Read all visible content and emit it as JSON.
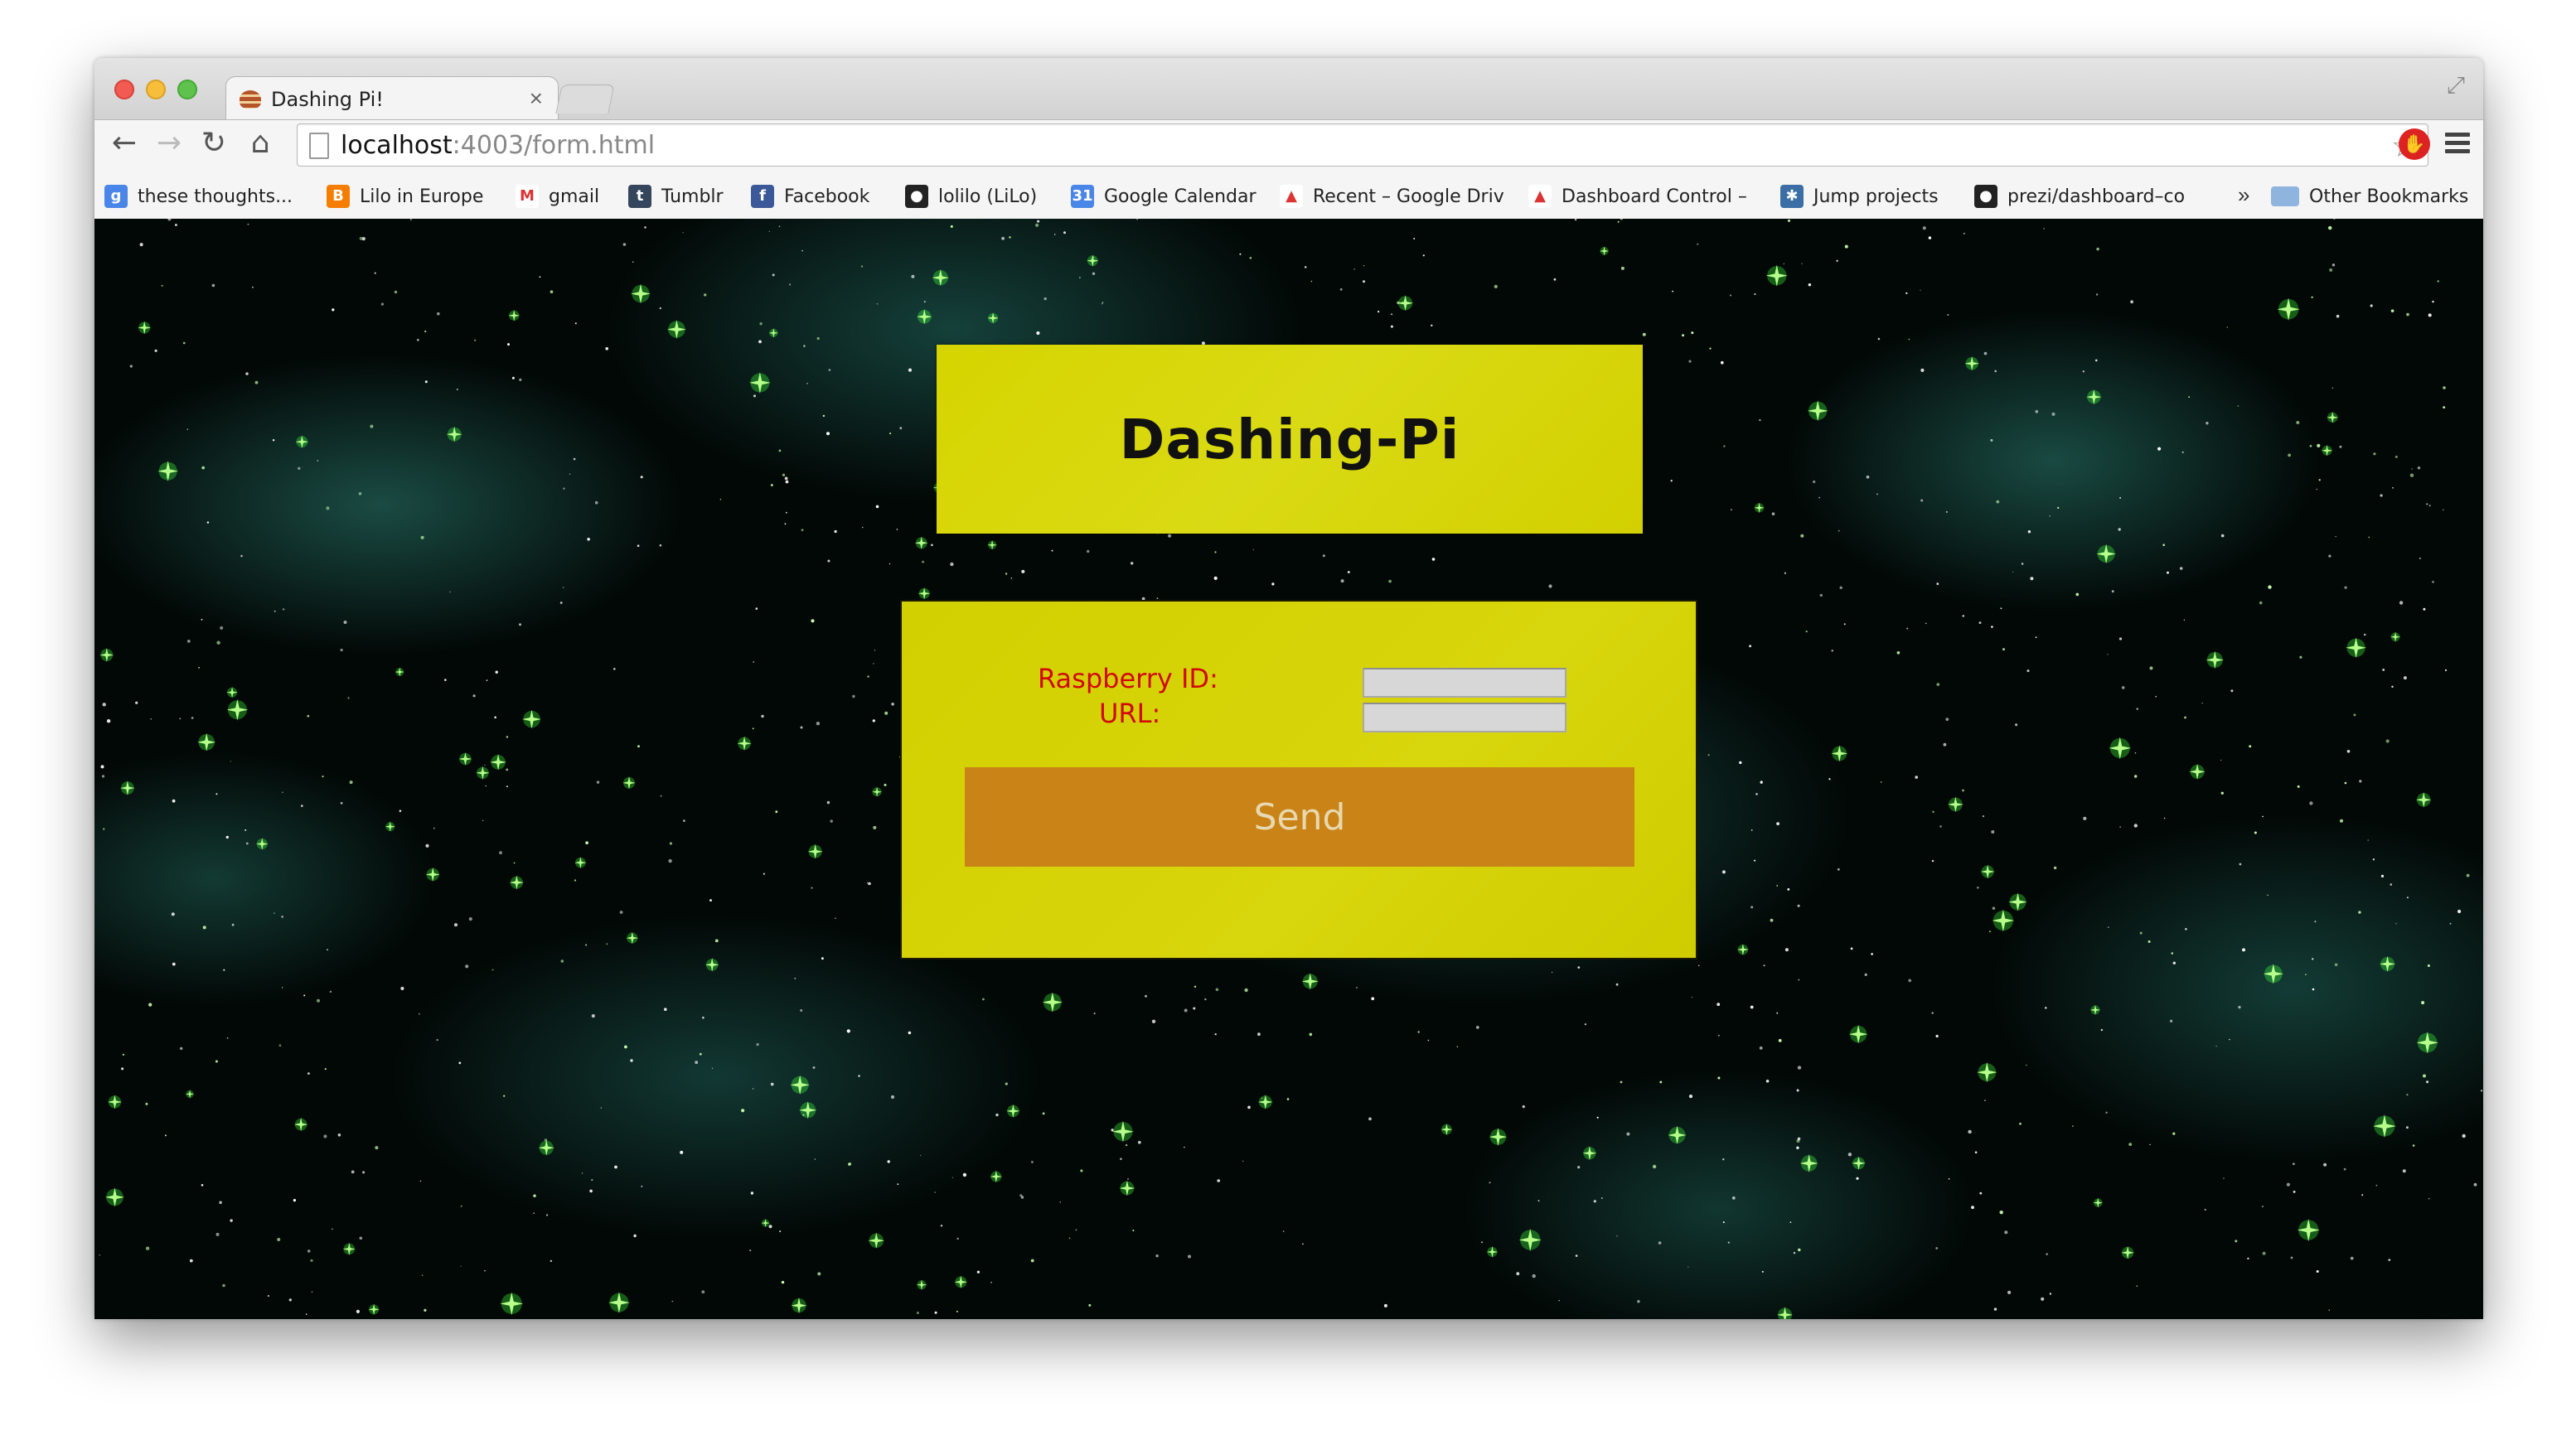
{
  "browser": {
    "tab": {
      "title": "Dashing Pi!",
      "close_glyph": "×",
      "favicon": "cake-icon"
    },
    "nav": {
      "back": "←",
      "forward": "→",
      "reload": "↻",
      "home": "⌂"
    },
    "address": {
      "host": "localhost",
      "path": ":4003/form.html"
    },
    "star_glyph": "☆",
    "extension_glyph": "✋",
    "bookmarks": [
      {
        "label": "these thoughts...",
        "icon": "google-icon",
        "color": "#4a86e8",
        "glyph": "g"
      },
      {
        "label": "Lilo in Europe",
        "icon": "blogger-icon",
        "color": "#f57d00",
        "glyph": "B"
      },
      {
        "label": "gmail",
        "icon": "gmail-icon",
        "color": "#ffffff",
        "glyph": "M"
      },
      {
        "label": "Tumblr",
        "icon": "tumblr-icon",
        "color": "#35465c",
        "glyph": "t"
      },
      {
        "label": "Facebook",
        "icon": "facebook-icon",
        "color": "#3b5998",
        "glyph": "f"
      },
      {
        "label": "lolilo (LiLo)",
        "icon": "github-icon",
        "color": "#222222",
        "glyph": "●"
      },
      {
        "label": "Google Calendar",
        "icon": "calendar-icon",
        "color": "#4a86e8",
        "glyph": "31"
      },
      {
        "label": "Recent – Google Driv",
        "icon": "drive-icon",
        "color": "#ffffff",
        "glyph": "▲"
      },
      {
        "label": "Dashboard Control –",
        "icon": "drive-icon",
        "color": "#ffffff",
        "glyph": "▲"
      },
      {
        "label": "Jump projects",
        "icon": "jump-icon",
        "color": "#3a6ea5",
        "glyph": "✱"
      },
      {
        "label": "prezi/dashboard–co",
        "icon": "github-icon",
        "color": "#222222",
        "glyph": "●"
      }
    ],
    "bookmarks_more": "»",
    "other_bookmarks": "Other Bookmarks"
  },
  "page": {
    "title": "Dashing-Pi",
    "form": {
      "raspberry_label": "Raspberry ID:",
      "url_label": "URL:",
      "raspberry_value": "",
      "url_value": "",
      "send_label": "Send"
    }
  },
  "colors": {
    "panel_yellow": "#d6d400",
    "label_red": "#d10808",
    "button_orange": "#c98316",
    "space_teal": "#2e8276"
  }
}
